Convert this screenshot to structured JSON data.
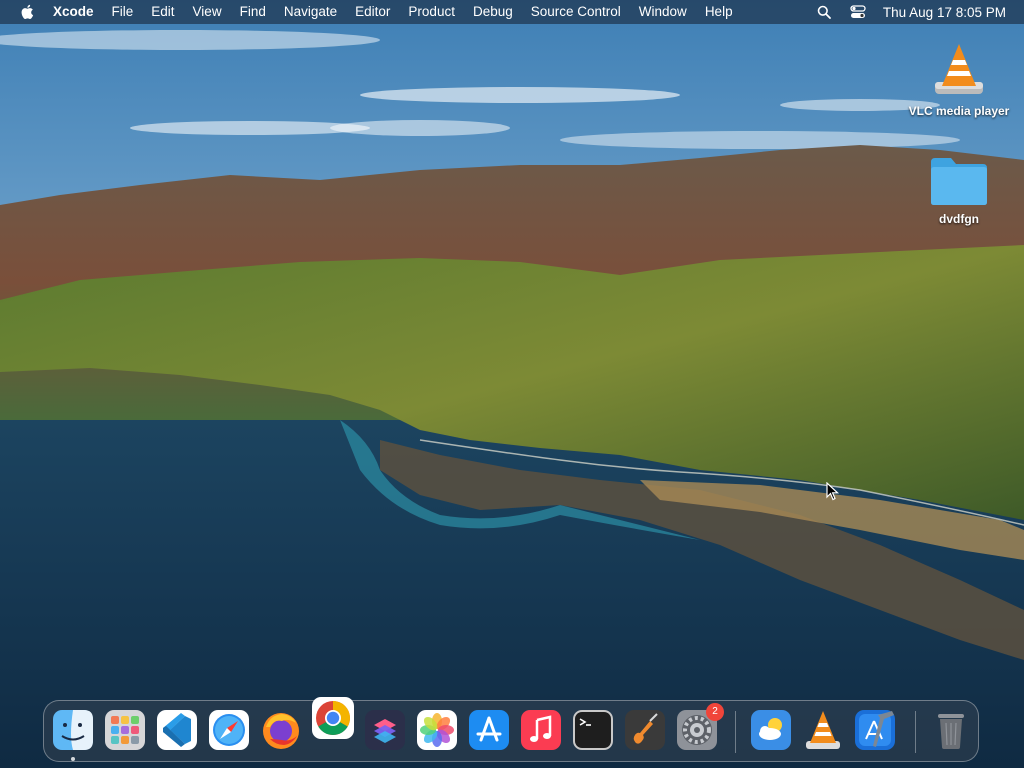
{
  "menubar": {
    "app_name": "Xcode",
    "items": [
      "File",
      "Edit",
      "View",
      "Find",
      "Navigate",
      "Editor",
      "Product",
      "Debug",
      "Source Control",
      "Window",
      "Help"
    ],
    "clock": "Thu Aug 17  8:05 PM",
    "status_icons": [
      "search-icon",
      "control-center-icon"
    ]
  },
  "desktop": {
    "icons": [
      {
        "label": "VLC media player",
        "icon": "vlc-cone-icon"
      },
      {
        "label": "dvdfgn",
        "icon": "folder-icon"
      }
    ]
  },
  "dock": {
    "apps": [
      {
        "name": "Finder",
        "icon": "finder-icon",
        "running": true
      },
      {
        "name": "Launchpad",
        "icon": "launchpad-icon"
      },
      {
        "name": "Visual Studio Code",
        "icon": "vscode-icon"
      },
      {
        "name": "Safari",
        "icon": "safari-icon"
      },
      {
        "name": "Firefox",
        "icon": "firefox-icon"
      },
      {
        "name": "Google Chrome",
        "icon": "chrome-icon"
      },
      {
        "name": "Shortcuts",
        "icon": "shortcuts-icon"
      },
      {
        "name": "Photos",
        "icon": "photos-icon"
      },
      {
        "name": "App Store",
        "icon": "app-store-icon"
      },
      {
        "name": "Music",
        "icon": "music-icon"
      },
      {
        "name": "Terminal",
        "icon": "terminal-icon"
      },
      {
        "name": "GarageBand",
        "icon": "garageband-icon"
      },
      {
        "name": "System Preferences",
        "icon": "settings-icon",
        "badge": "2"
      },
      {
        "name": "Weather",
        "icon": "weather-icon"
      },
      {
        "name": "VLC",
        "icon": "vlc-cone-icon"
      },
      {
        "name": "Xcode",
        "icon": "xcode-icon"
      },
      {
        "name": "Trash",
        "icon": "trash-icon"
      }
    ]
  },
  "colors": {
    "menubar_bg": "#1e2a3a",
    "badge": "#f0453a",
    "folder": "#5ab8ef"
  }
}
